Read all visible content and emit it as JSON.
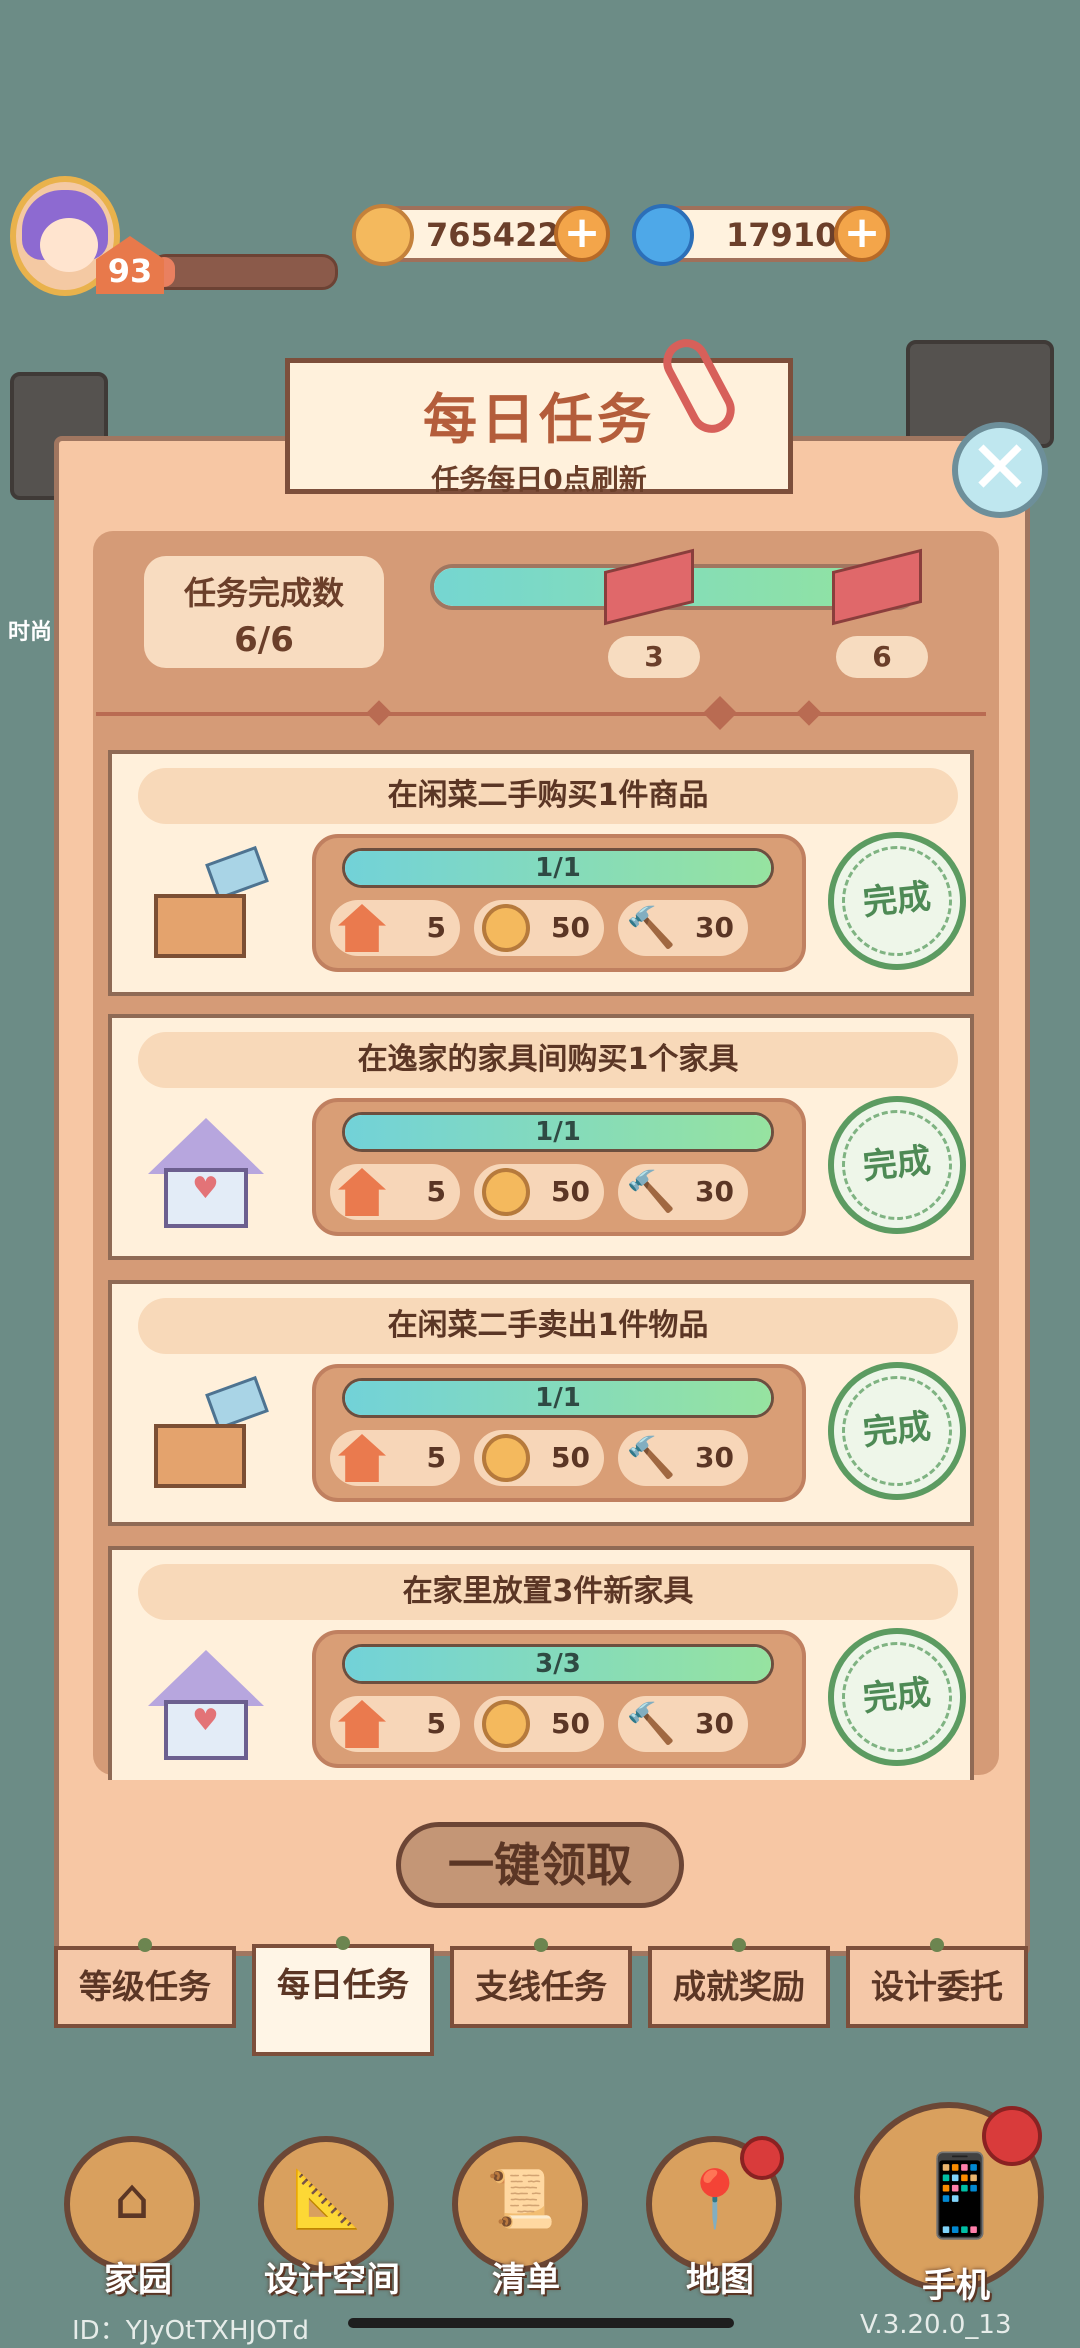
{
  "hud": {
    "level": "93",
    "xp_fraction": 0.12,
    "coins": "765422",
    "gems": "17910",
    "plus_symbol": "+"
  },
  "side_label": "时尚",
  "panel": {
    "title": "每日任务",
    "subtitle": "任务每日0点刷新",
    "count_label": "任务完成数",
    "count_value": "6/6",
    "progress_fraction": 1.0,
    "milestones": [
      "3",
      "6"
    ],
    "close_symbol": "✕"
  },
  "tasks": [
    {
      "title": "在闲菜二手购买1件商品",
      "icon": "box-icon",
      "progress": "1/1",
      "progress_fraction": 1.0,
      "rewards": [
        "5",
        "50",
        "30"
      ],
      "status": "完成"
    },
    {
      "title": "在逸家的家具间购买1个家具",
      "icon": "house-icon",
      "progress": "1/1",
      "progress_fraction": 1.0,
      "rewards": [
        "5",
        "50",
        "30"
      ],
      "status": "完成"
    },
    {
      "title": "在闲菜二手卖出1件物品",
      "icon": "box-icon",
      "progress": "1/1",
      "progress_fraction": 1.0,
      "rewards": [
        "5",
        "50",
        "30"
      ],
      "status": "完成"
    },
    {
      "title": "在家里放置3件新家具",
      "icon": "house-icon",
      "progress": "3/3",
      "progress_fraction": 1.0,
      "rewards": [
        "5",
        "50",
        "30"
      ],
      "status": "完成"
    }
  ],
  "claim_all": "一键领取",
  "tabs": [
    {
      "label": "等级任务",
      "active": false
    },
    {
      "label": "每日任务",
      "active": true
    },
    {
      "label": "支线任务",
      "active": false
    },
    {
      "label": "成就奖励",
      "active": false
    },
    {
      "label": "设计委托",
      "active": false
    }
  ],
  "nav": [
    {
      "label": "家园",
      "icon": "home-icon"
    },
    {
      "label": "设计空间",
      "icon": "design-icon"
    },
    {
      "label": "清单",
      "icon": "list-icon"
    },
    {
      "label": "地图",
      "icon": "map-pin-icon"
    },
    {
      "label": "手机",
      "icon": "phone-icon"
    }
  ],
  "footer": {
    "id": "ID：YJyOtTXHJOTd",
    "version": "V.3.20.0_13"
  },
  "colors": {
    "accent": "#b45d3b",
    "progress": "#75d6d1",
    "stamp": "#5c9b61",
    "notification": "#d93b3b"
  }
}
